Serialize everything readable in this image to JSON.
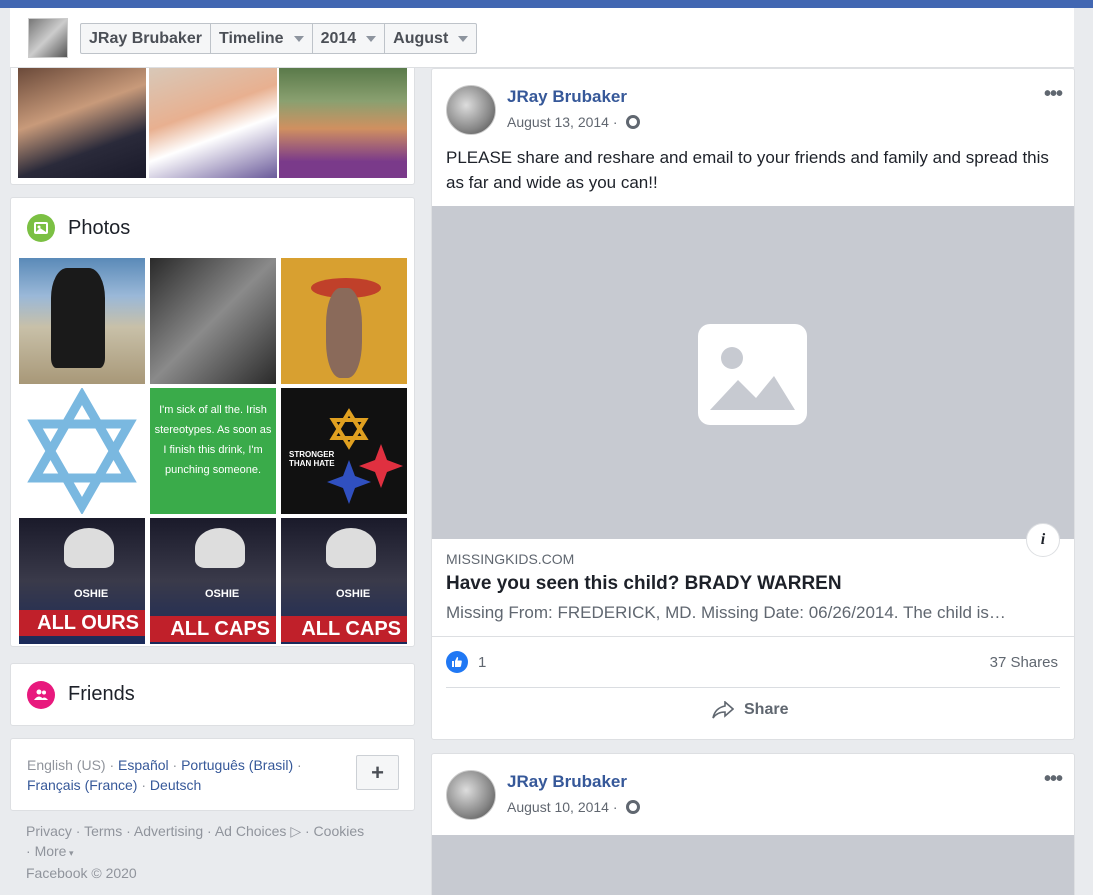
{
  "header": {
    "profile_name": "JRay Brubaker",
    "crumbs": [
      "JRay Brubaker",
      "Timeline",
      "2014",
      "August"
    ]
  },
  "left": {
    "top_photos": [
      {
        "alt": "two women holding a t-shirt"
      },
      {
        "alt": "two women selfie with sunglasses"
      },
      {
        "alt": "two women at stadium"
      }
    ],
    "photos": {
      "title": "Photos",
      "grid_texts": {
        "irish": "I'm sick of all the. Irish stereotypes. As soon as I finish this drink, I'm punching someone.",
        "stronger": "STRONGER THAN HATE",
        "allours": "ALL OURS",
        "allcaps1": "ALL CAPS",
        "allcaps2": "ALL CAPS",
        "oshie": "OSHIE"
      }
    },
    "friends": {
      "title": "Friends"
    },
    "languages": {
      "current": "English (US)",
      "others": [
        "Español",
        "Português (Brasil)",
        "Français (France)",
        "Deutsch"
      ],
      "plus": "+"
    },
    "footer": {
      "links": [
        "Privacy",
        "Terms",
        "Advertising",
        "Ad Choices",
        "Cookies",
        "More"
      ],
      "copyright": "Facebook © 2020"
    }
  },
  "posts": [
    {
      "author": "JRay Brubaker",
      "date": "August 13, 2014",
      "text": "PLEASE share and reshare and email to your friends and family and spread this as far and wide as you can!!",
      "link": {
        "domain": "MISSINGKIDS.COM",
        "title": "Have you seen this child? BRADY WARREN",
        "description": "Missing From: FREDERICK, MD. Missing Date: 06/26/2014. The child is…"
      },
      "likes": "1",
      "shares": "37 Shares",
      "share_label": "Share"
    },
    {
      "author": "JRay Brubaker",
      "date": "August 10, 2014"
    }
  ],
  "colors": {
    "brand": "#4267b2",
    "link": "#365899",
    "photos_icon": "#7bc043",
    "friends_icon": "#e8197d",
    "like": "#2078f4"
  }
}
